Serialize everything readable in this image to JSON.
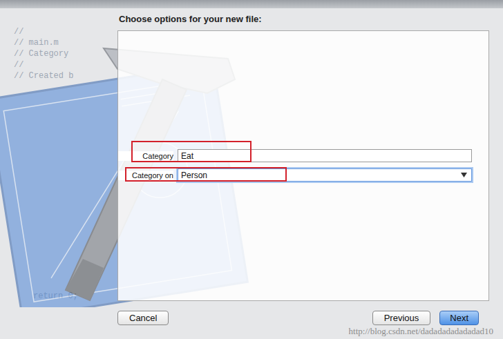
{
  "background_code": [
    "//",
    "//  main.m",
    "//  Category",
    "//",
    "//  Created b"
  ],
  "background_code_tail": "return 0;",
  "dialog": {
    "title": "Choose options for your new file:"
  },
  "fields": [
    {
      "label": "Category",
      "value": "Eat",
      "kind": "text",
      "focused": false,
      "highlighted": true
    },
    {
      "label": "Category on",
      "value": "Person",
      "kind": "combo",
      "focused": true,
      "highlighted": true
    }
  ],
  "buttons": [
    {
      "label": "Cancel",
      "default": false
    },
    {
      "label": "Previous",
      "default": false
    },
    {
      "label": "Next",
      "default": true
    }
  ],
  "watermark": "http://blog.csdn.net/dadadadadadadad10"
}
